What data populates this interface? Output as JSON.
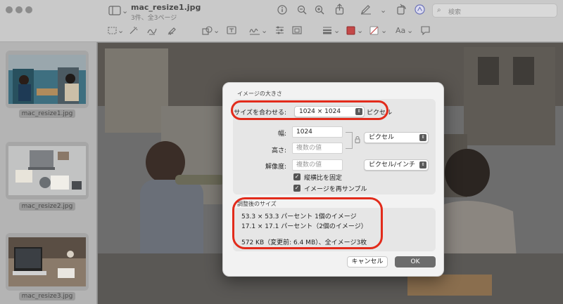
{
  "window": {
    "title": "mac_resize1.jpg",
    "subtitle": "3件、全3ページ",
    "search_placeholder": "検索"
  },
  "toolbar_icons": [
    "sidebar-icon",
    "info-icon",
    "zoom-out-icon",
    "zoom-in-icon",
    "share-icon",
    "markup-pen-icon",
    "rotate-icon",
    "markup-circle-icon",
    "select-rect-icon",
    "sketch-icon",
    "draw-icon",
    "shapes-icon",
    "text-box-icon",
    "sign-icon",
    "adjust-color-icon",
    "adjust-size-icon",
    "line-style-icon",
    "border-color-icon",
    "fill-color-icon",
    "text-style-icon",
    "note-icon"
  ],
  "sidebar": {
    "items": [
      {
        "label": "mac_resize1.jpg",
        "selected": true
      },
      {
        "label": "mac_resize2.jpg",
        "selected": false
      },
      {
        "label": "mac_resize3.jpg",
        "selected": false
      }
    ]
  },
  "dialog": {
    "image_size_title": "イメージの大きさ",
    "fit_label": "サイズを合わせる:",
    "fit_value": "1024 × 1024",
    "fit_unit": "ピクセル",
    "width_label": "幅:",
    "width_value": "1024",
    "height_label": "高さ:",
    "height_placeholder": "複数の値",
    "resolution_label": "解像度:",
    "resolution_placeholder": "複数の値",
    "unit_popup": "ピクセル",
    "resolution_unit_popup": "ピクセル/インチ",
    "scale_proportionally": "縦横比を固定",
    "resample": "イメージを再サンプル",
    "resulting_title": "調整後のサイズ",
    "result_line1": "53.3 × 53.3 パーセント 1個のイメージ",
    "result_line2": "17.1 × 17.1 パーセント（2個のイメージ）",
    "result_line3": "572 KB（変更前: 6.4 MB）、全イメージ3枚",
    "cancel": "キャンセル",
    "ok": "OK"
  },
  "colors": {
    "highlight": "#e22b1b",
    "ok_button": "#6c6c6c"
  }
}
